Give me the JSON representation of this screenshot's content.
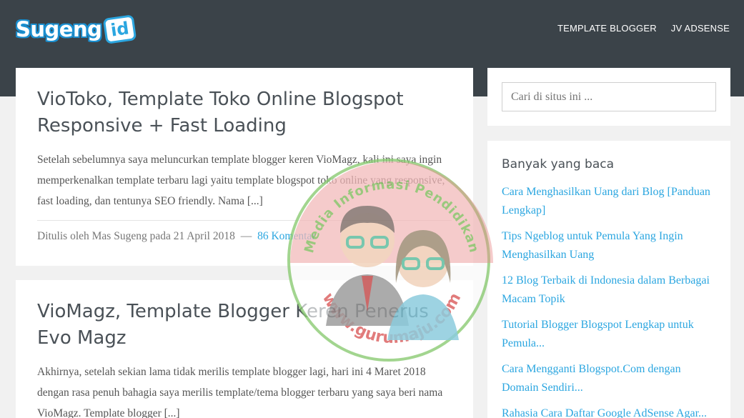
{
  "header": {
    "logo_main": "Sugeng",
    "logo_badge": "id",
    "nav": [
      "TEMPLATE BLOGGER",
      "JV ADSENSE"
    ]
  },
  "posts": [
    {
      "title": "VioToko, Template Toko Online Blogspot Responsive + Fast Loading",
      "excerpt": "Setelah sebelumnya saya meluncurkan template blogger keren VioMagz, kali ini saya ingin memperkenalkan template terbaru lagi yaitu template blogspot toko online yang responsive, fast loading, dan tentunya SEO friendly. Nama [...]",
      "meta_prefix": "Ditulis oleh Mas Sugeng pada 21 April 2018",
      "meta_sep": "—",
      "comments": "86 Komentar"
    },
    {
      "title": "VioMagz, Template Blogger Keren Penerus Evo Magz",
      "excerpt": "Akhirnya, setelah sekian lama tidak merilis template blogger lagi, hari ini 4 Maret 2018 dengan rasa penuh bahagia saya merilis template/tema blogger terbaru yang saya beri nama VioMagz. Template blogger [...]"
    }
  ],
  "sidebar": {
    "search_placeholder": "Cari di situs ini ...",
    "popular_title": "Banyak yang baca",
    "popular_items": [
      "Cara Menghasilkan Uang dari Blog [Panduan Lengkap]",
      "Tips Ngeblog untuk Pemula Yang Ingin Menghasilkan Uang",
      "12 Blog Terbaik di Indonesia dalam Berbagai Macam Topik",
      "Tutorial Blogger Blogspot Lengkap untuk Pemula...",
      "Cara Mengganti Blogspot.Com dengan Domain Sendiri...",
      "Rahasia Cara Daftar Google AdSense Agar..."
    ]
  },
  "watermark": {
    "arc_text": "Media Informasi Pendidikan",
    "url_text": "www.gurumaju.com"
  }
}
